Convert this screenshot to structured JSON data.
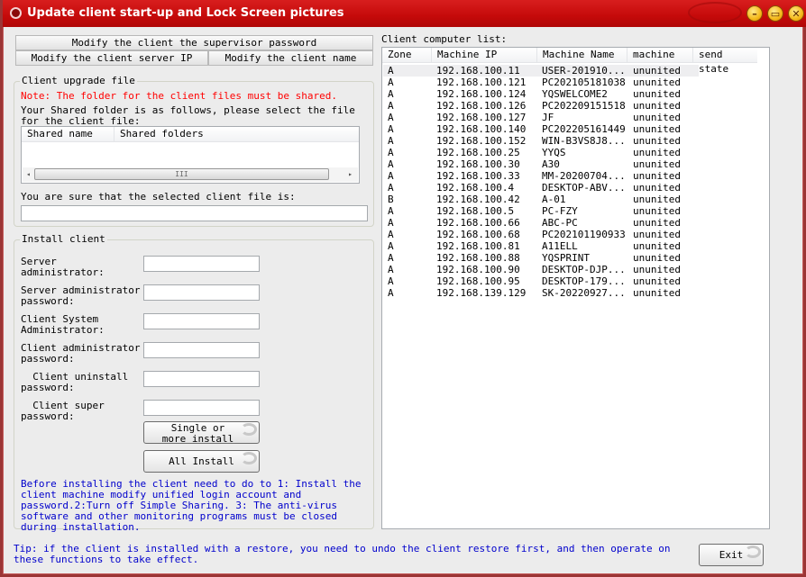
{
  "window": {
    "title": "Update client start-up and Lock Screen pictures",
    "icon": "app-swirl-icon",
    "controls": {
      "minimize": "minimize-icon",
      "maximize": "maximize-icon",
      "close": "close-icon",
      "minimize_glyph": "–",
      "maximize_glyph": "▭",
      "close_glyph": "✕"
    }
  },
  "tabs": {
    "supervisor_password": "Modify the client the supervisor password",
    "server_ip": "Modify the client server IP",
    "client_name": "Modify the client name"
  },
  "upgrade": {
    "legend": "Client upgrade file",
    "note": "Note: The folder for the client files must be shared.",
    "instruction": "Your Shared folder is as follows, please select the file for the client file:",
    "columns": [
      "Shared name",
      "Shared folders"
    ],
    "rows": [],
    "scroll_left": "◂",
    "scroll_right": "▸",
    "scroll_grip": "III",
    "confirm_label": "You are sure that the selected client file is:",
    "selected_file_value": ""
  },
  "install": {
    "legend": "Install client",
    "fields": [
      {
        "label": "Server administrator:",
        "value": ""
      },
      {
        "label": "Server administrator password:",
        "value": ""
      },
      {
        "label": "Client System Administrator:",
        "value": ""
      },
      {
        "label": "Client administrator password:",
        "value": ""
      },
      {
        "label": "  Client uninstall password:",
        "value": ""
      },
      {
        "label": "  Client super password:",
        "value": ""
      }
    ],
    "single_install_button": "Single or more install",
    "all_install_button": "All Install",
    "instructions": "Before installing the client need to do to 1: Install the client machine modify unified login account and password.2:Turn off Simple Sharing. 3: The anti-virus software and other monitoring programs must be closed during installation."
  },
  "client_list": {
    "label": "Client computer list:",
    "columns": [
      "Zone",
      "Machine IP",
      "Machine Name",
      "machine st",
      "send state"
    ],
    "rows": [
      {
        "zone": "A",
        "ip": "192.168.100.11",
        "name": "USER-201910...",
        "state": "ununited",
        "send": ""
      },
      {
        "zone": "A",
        "ip": "192.168.100.121",
        "name": "PC202105181038",
        "state": "ununited",
        "send": ""
      },
      {
        "zone": "A",
        "ip": "192.168.100.124",
        "name": "YQSWELCOME2",
        "state": "ununited",
        "send": ""
      },
      {
        "zone": "A",
        "ip": "192.168.100.126",
        "name": "PC202209151518",
        "state": "ununited",
        "send": ""
      },
      {
        "zone": "A",
        "ip": "192.168.100.127",
        "name": "JF",
        "state": "ununited",
        "send": ""
      },
      {
        "zone": "A",
        "ip": "192.168.100.140",
        "name": "PC202205161449",
        "state": "ununited",
        "send": ""
      },
      {
        "zone": "A",
        "ip": "192.168.100.152",
        "name": "WIN-B3VS8J8...",
        "state": "ununited",
        "send": ""
      },
      {
        "zone": "A",
        "ip": "192.168.100.25",
        "name": "YYQS",
        "state": "ununited",
        "send": ""
      },
      {
        "zone": "A",
        "ip": "192.168.100.30",
        "name": "A30",
        "state": "ununited",
        "send": ""
      },
      {
        "zone": "A",
        "ip": "192.168.100.33",
        "name": "MM-20200704...",
        "state": "ununited",
        "send": ""
      },
      {
        "zone": "A",
        "ip": "192.168.100.4",
        "name": "DESKTOP-ABV...",
        "state": "ununited",
        "send": ""
      },
      {
        "zone": "B",
        "ip": "192.168.100.42",
        "name": "A-01",
        "state": "ununited",
        "send": ""
      },
      {
        "zone": "A",
        "ip": "192.168.100.5",
        "name": "PC-FZY",
        "state": "ununited",
        "send": ""
      },
      {
        "zone": "A",
        "ip": "192.168.100.66",
        "name": "ABC-PC",
        "state": "ununited",
        "send": ""
      },
      {
        "zone": "A",
        "ip": "192.168.100.68",
        "name": "PC202101190933",
        "state": "ununited",
        "send": ""
      },
      {
        "zone": "A",
        "ip": "192.168.100.81",
        "name": "A11ELL",
        "state": "ununited",
        "send": ""
      },
      {
        "zone": "A",
        "ip": "192.168.100.88",
        "name": "YQSPRINT",
        "state": "ununited",
        "send": ""
      },
      {
        "zone": "A",
        "ip": "192.168.100.90",
        "name": "DESKTOP-DJP...",
        "state": "ununited",
        "send": ""
      },
      {
        "zone": "A",
        "ip": "192.168.100.95",
        "name": "DESKTOP-179...",
        "state": "ununited",
        "send": ""
      },
      {
        "zone": "A",
        "ip": "192.168.139.129",
        "name": "SK-20220927...",
        "state": "ununited",
        "send": ""
      }
    ],
    "selected_index": 0
  },
  "footer": {
    "tip": "Tip: if the client is installed with a restore, you need to undo the client restore first, and then operate on these functions to take effect.",
    "exit_button": "Exit"
  },
  "colors": {
    "titlebar": "#c50a0a",
    "note": "#ff0000",
    "info_text": "#0000cc",
    "frame": "#9b3535"
  }
}
